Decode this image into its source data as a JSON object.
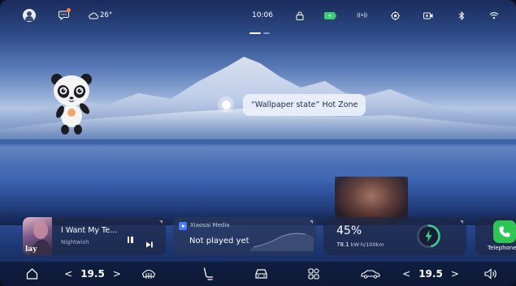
{
  "status_bar": {
    "weather_temp": "26°",
    "time": "10:06",
    "icons": [
      "avatar-icon",
      "message-icon",
      "cloud-icon",
      "lock-icon",
      "battery-icon",
      "wireless-icon",
      "navigation-icon",
      "dashcam-icon",
      "bluetooth-icon",
      "wifi-icon"
    ]
  },
  "page_indicator": {
    "count": 2,
    "active": 0
  },
  "hotspot": {
    "label": "“Wallpaper state” Hot Zone"
  },
  "music": {
    "title": "I Want My Te...",
    "artist": "Nightwish",
    "album_text": "lay"
  },
  "media": {
    "app_name": "Xiaosai Media",
    "status": "Not played yet"
  },
  "battery": {
    "percent": "45%",
    "consumption_value": "78.1",
    "consumption_unit": "kW·h/100km",
    "level": 0.45
  },
  "phone": {
    "label": "Telephone"
  },
  "dock": {
    "left_temp": "19.5",
    "right_temp": "19.5",
    "left_arrow": "<",
    "right_arrow": ">"
  },
  "colors": {
    "phone_green": "#2dc653",
    "battery_ring": "#3ecf8e",
    "media_blue": "#4a7cff",
    "message_dot": "#ff7a3a"
  }
}
